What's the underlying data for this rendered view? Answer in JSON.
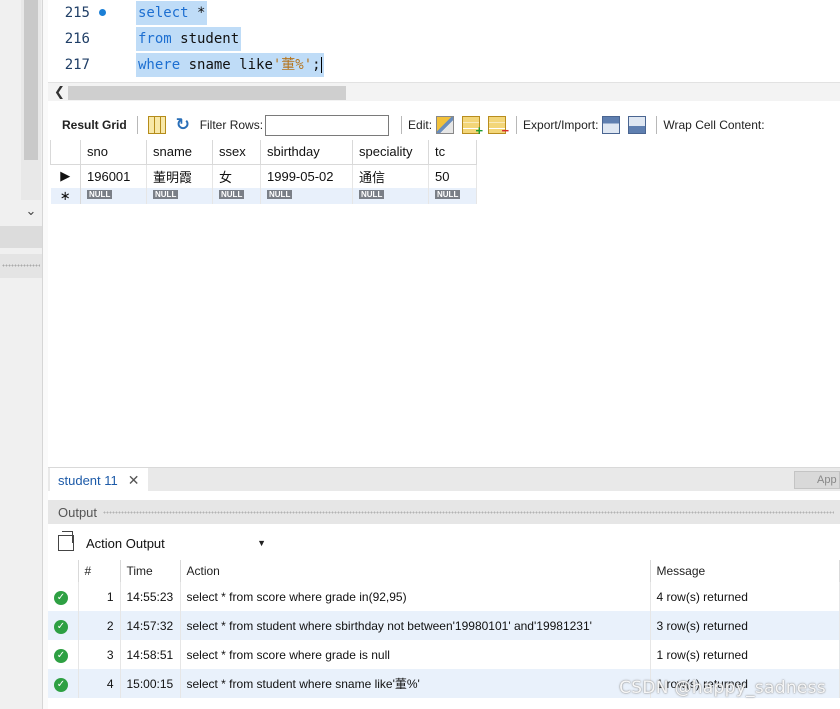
{
  "editor": {
    "lines": [
      {
        "number": "215",
        "kw": "select",
        "rest": " *"
      },
      {
        "number": "216",
        "kw": "from",
        "rest": " student"
      },
      {
        "number": "217",
        "kw": "where",
        "rest": " sname like",
        "string": "'董%'",
        "tail": ";"
      }
    ]
  },
  "toolbar": {
    "result_grid_label": "Result Grid",
    "filter_rows_label": "Filter Rows:",
    "filter_rows_value": "",
    "edit_label": "Edit:",
    "export_import_label": "Export/Import:",
    "wrap_cell_label": "Wrap Cell Content:"
  },
  "result_grid": {
    "columns": [
      "sno",
      "sname",
      "ssex",
      "sbirthday",
      "speciality",
      "tc"
    ],
    "rows": [
      [
        "196001",
        "董明霞",
        "女",
        "1999-05-02",
        "通信",
        "50"
      ]
    ],
    "null_label": "NULL"
  },
  "tabs": {
    "result_tab_label": "student 11",
    "apply_label": "App"
  },
  "output": {
    "header_label": "Output",
    "selector_value": "Action Output",
    "columns": [
      "",
      "#",
      "Time",
      "Action",
      "Message"
    ],
    "rows": [
      {
        "n": "1",
        "time": "14:55:23",
        "action": "select * from score where grade in(92,95)",
        "message": "4 row(s) returned"
      },
      {
        "n": "2",
        "time": "14:57:32",
        "action": "select * from student where sbirthday not between'19980101' and'19981231'",
        "message": "3 row(s) returned"
      },
      {
        "n": "3",
        "time": "14:58:51",
        "action": "select * from score where grade is null",
        "message": "1 row(s) returned"
      },
      {
        "n": "4",
        "time": "15:00:15",
        "action": "select * from student where sname like'董%'",
        "message": "1 row(s) returned"
      }
    ]
  },
  "watermark": "CSDN @happy_sadness",
  "colors": {
    "selection": "#bfdcf7",
    "keyword": "#1d6fd1",
    "string": "#b5741d",
    "success": "#2ea043",
    "alt_row": "#e9f1fb"
  }
}
